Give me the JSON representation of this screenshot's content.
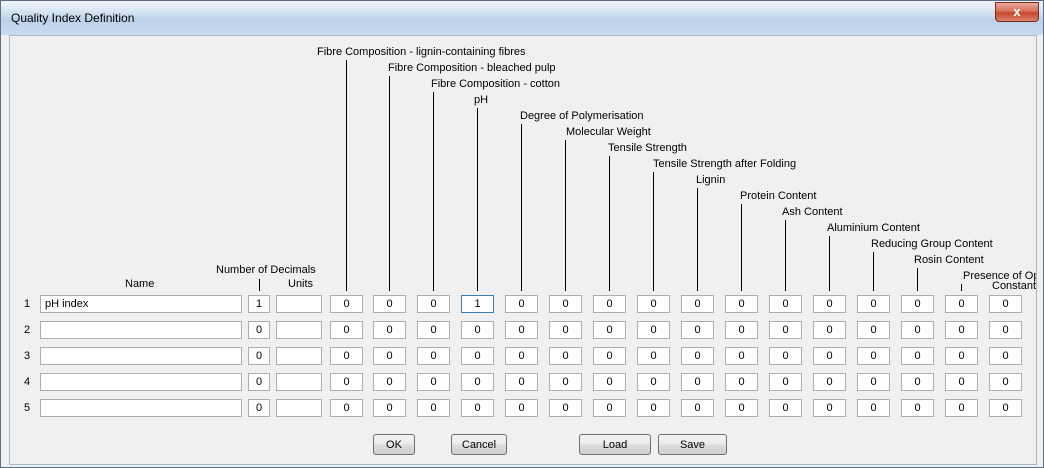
{
  "window": {
    "title": "Quality Index Definition",
    "close_label": "x"
  },
  "headers": {
    "name": "Name",
    "decimals": "Number of Decimals",
    "units": "Units",
    "properties": [
      "Fibre Composition - lignin-containing fibres",
      "Fibre Composition - bleached pulp",
      "Fibre Composition - cotton",
      "pH",
      "Degree of Polymerisation",
      "Molecular Weight",
      "Tensile Strength",
      "Tensile Strength after Folding",
      "Lignin",
      "Protein Content",
      "Ash Content",
      "Aluminium Content",
      "Reducing Group Content",
      "Rosin Content",
      "Presence of Optica",
      "Constant"
    ]
  },
  "rows": [
    {
      "num": "1",
      "name": "pH index",
      "decimals": "1",
      "units": "",
      "values": [
        "0",
        "0",
        "0",
        "1",
        "0",
        "0",
        "0",
        "0",
        "0",
        "0",
        "0",
        "0",
        "0",
        "0",
        "0",
        "0"
      ]
    },
    {
      "num": "2",
      "name": "",
      "decimals": "0",
      "units": "",
      "values": [
        "0",
        "0",
        "0",
        "0",
        "0",
        "0",
        "0",
        "0",
        "0",
        "0",
        "0",
        "0",
        "0",
        "0",
        "0",
        "0"
      ]
    },
    {
      "num": "3",
      "name": "",
      "decimals": "0",
      "units": "",
      "values": [
        "0",
        "0",
        "0",
        "0",
        "0",
        "0",
        "0",
        "0",
        "0",
        "0",
        "0",
        "0",
        "0",
        "0",
        "0",
        "0"
      ]
    },
    {
      "num": "4",
      "name": "",
      "decimals": "0",
      "units": "",
      "values": [
        "0",
        "0",
        "0",
        "0",
        "0",
        "0",
        "0",
        "0",
        "0",
        "0",
        "0",
        "0",
        "0",
        "0",
        "0",
        "0"
      ]
    },
    {
      "num": "5",
      "name": "",
      "decimals": "0",
      "units": "",
      "values": [
        "0",
        "0",
        "0",
        "0",
        "0",
        "0",
        "0",
        "0",
        "0",
        "0",
        "0",
        "0",
        "0",
        "0",
        "0",
        "0"
      ]
    }
  ],
  "buttons": {
    "ok": "OK",
    "cancel": "Cancel",
    "load": "Load",
    "save": "Save"
  }
}
